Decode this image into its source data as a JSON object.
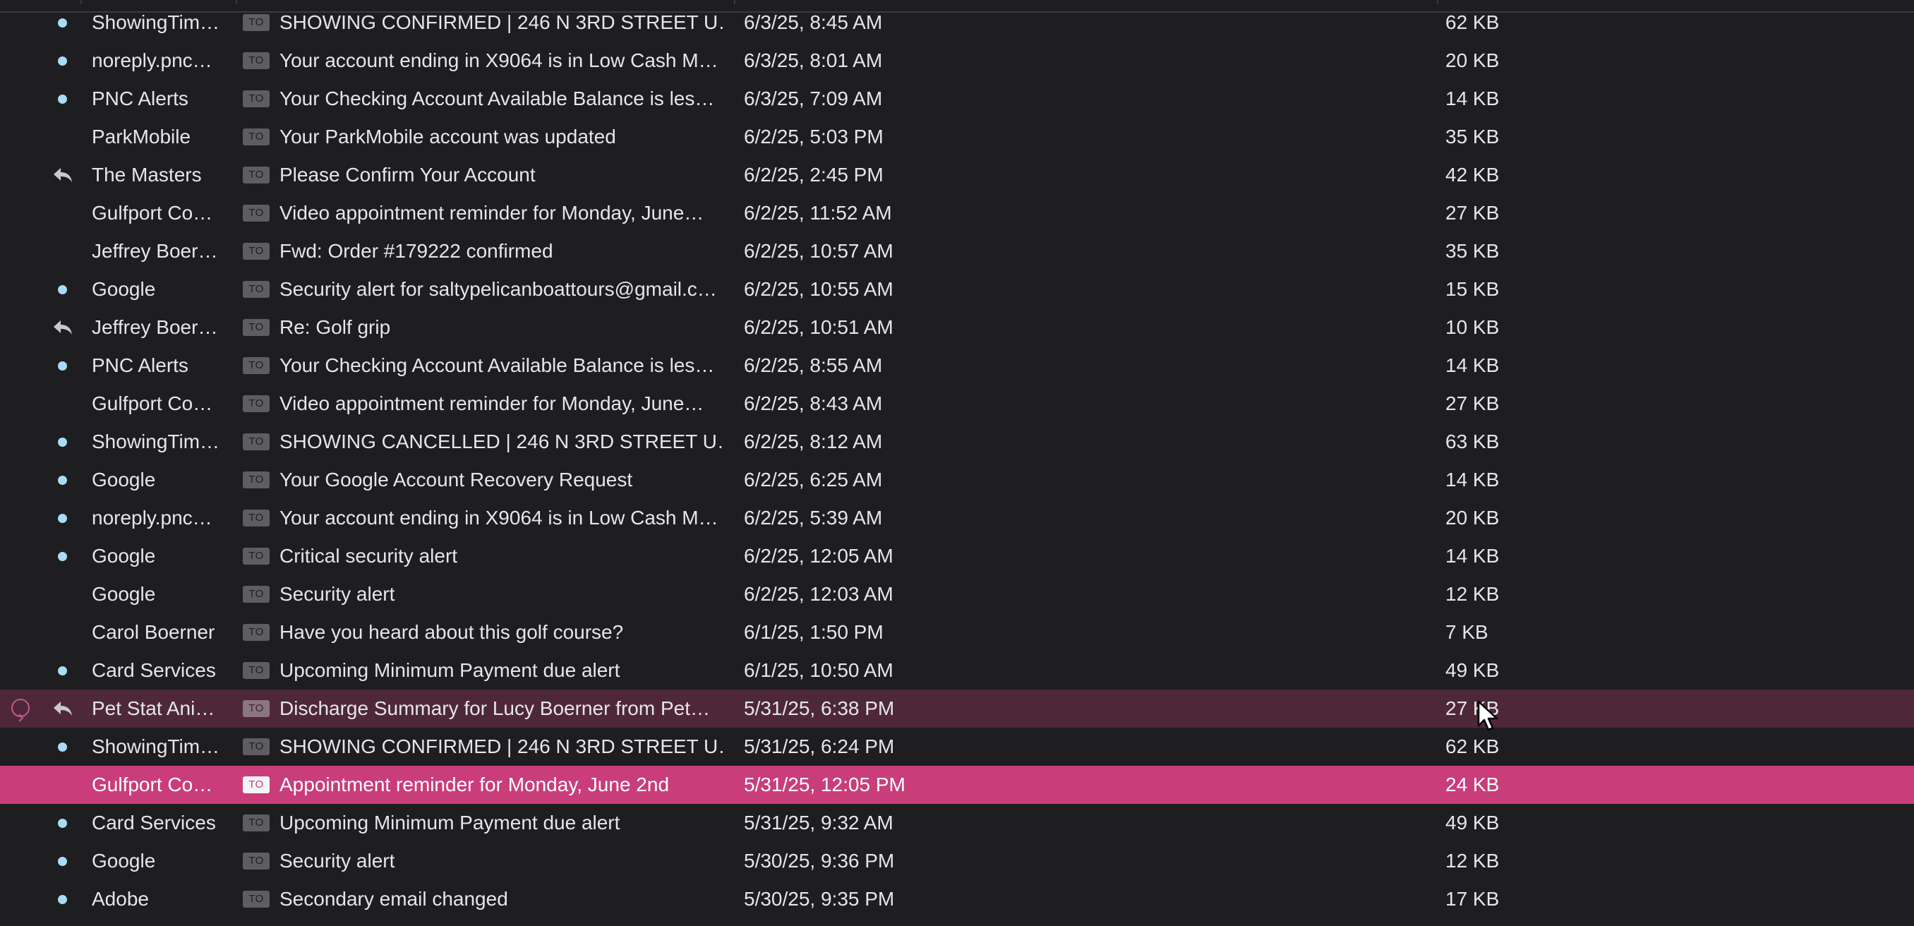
{
  "colors": {
    "background": "#1e1e21",
    "unread_dot": "#a8dcf5",
    "selected_row": "#c93d7a",
    "hover_row": "#4e2839"
  },
  "icons": {
    "unread": "unread-dot-icon",
    "replied": "reply-arrow-icon",
    "to_badge": "to-badge-icon",
    "thread": "chevron-circle-icon",
    "pointer": "mouse-cursor-icon"
  },
  "messages": [
    {
      "status": "unread",
      "from": "ShowingTim…",
      "badge": "TO",
      "subject": "SHOWING CONFIRMED | 246 N 3RD STREET U…",
      "date": "6/3/25, 8:45 AM",
      "size": "62 KB"
    },
    {
      "status": "unread",
      "from": "noreply.pnc…",
      "badge": "TO",
      "subject": "Your account ending in X9064 is in Low Cash M…",
      "date": "6/3/25, 8:01 AM",
      "size": "20 KB"
    },
    {
      "status": "unread",
      "from": "PNC Alerts",
      "badge": "TO",
      "subject": "Your Checking Account Available Balance is les…",
      "date": "6/3/25, 7:09 AM",
      "size": "14 KB"
    },
    {
      "status": "read",
      "from": "ParkMobile",
      "badge": "TO",
      "subject": "Your ParkMobile account was updated",
      "date": "6/2/25, 5:03 PM",
      "size": "35 KB"
    },
    {
      "status": "replied",
      "from": "The Masters",
      "badge": "TO",
      "subject": "Please Confirm Your Account",
      "date": "6/2/25, 2:45 PM",
      "size": "42 KB"
    },
    {
      "status": "read",
      "from": "Gulfport Co…",
      "badge": "TO",
      "subject": "Video appointment reminder for Monday, June…",
      "date": "6/2/25, 11:52 AM",
      "size": "27 KB"
    },
    {
      "status": "read",
      "from": "Jeffrey Boer…",
      "badge": "TO",
      "subject": "Fwd: Order #179222 confirmed",
      "date": "6/2/25, 10:57 AM",
      "size": "35 KB"
    },
    {
      "status": "unread",
      "from": "Google",
      "badge": "TO",
      "subject": "Security alert for saltypelicanboattours@gmail.c…",
      "date": "6/2/25, 10:55 AM",
      "size": "15 KB"
    },
    {
      "status": "replied",
      "from": "Jeffrey Boer…",
      "badge": "TO",
      "subject": "Re: Golf grip",
      "date": "6/2/25, 10:51 AM",
      "size": "10 KB"
    },
    {
      "status": "unread",
      "from": "PNC Alerts",
      "badge": "TO",
      "subject": "Your Checking Account Available Balance is les…",
      "date": "6/2/25, 8:55 AM",
      "size": "14 KB"
    },
    {
      "status": "read",
      "from": "Gulfport Co…",
      "badge": "TO",
      "subject": "Video appointment reminder for Monday, June…",
      "date": "6/2/25, 8:43 AM",
      "size": "27 KB"
    },
    {
      "status": "unread",
      "from": "ShowingTim…",
      "badge": "TO",
      "subject": "SHOWING  CANCELLED | 246 N 3RD STREET U…",
      "date": "6/2/25, 8:12 AM",
      "size": "63 KB"
    },
    {
      "status": "unread",
      "from": "Google",
      "badge": "TO",
      "subject": "Your Google Account Recovery Request",
      "date": "6/2/25, 6:25 AM",
      "size": "14 KB"
    },
    {
      "status": "unread",
      "from": "noreply.pnc…",
      "badge": "TO",
      "subject": "Your account ending in X9064 is in Low Cash M…",
      "date": "6/2/25, 5:39 AM",
      "size": "20 KB"
    },
    {
      "status": "unread",
      "from": "Google",
      "badge": "TO",
      "subject": "Critical security alert",
      "date": "6/2/25, 12:05 AM",
      "size": "14 KB"
    },
    {
      "status": "read",
      "from": "Google",
      "badge": "TO",
      "subject": "Security alert",
      "date": "6/2/25, 12:03 AM",
      "size": "12 KB"
    },
    {
      "status": "read",
      "from": "Carol Boerner",
      "badge": "TO",
      "subject": "Have you heard about this golf course?",
      "date": "6/1/25, 1:50 PM",
      "size": "7 KB"
    },
    {
      "status": "unread",
      "from": "Card Services",
      "badge": "TO",
      "subject": "Upcoming Minimum Payment due alert",
      "date": "6/1/25, 10:50 AM",
      "size": "49 KB"
    },
    {
      "status": "replied",
      "from": "Pet Stat Ani…",
      "badge": "TO",
      "subject": "Discharge Summary for Lucy Boerner from Pet…",
      "date": "5/31/25, 6:38 PM",
      "size": "27 KB",
      "state": "hover",
      "thread": true
    },
    {
      "status": "unread",
      "from": "ShowingTim…",
      "badge": "TO",
      "subject": "SHOWING CONFIRMED | 246 N 3RD STREET U…",
      "date": "5/31/25, 6:24 PM",
      "size": "62 KB"
    },
    {
      "status": "read",
      "from": "Gulfport Co…",
      "badge": "TO",
      "subject": "Appointment reminder for Monday, June 2nd",
      "date": "5/31/25, 12:05 PM",
      "size": "24 KB",
      "state": "selected"
    },
    {
      "status": "unread",
      "from": "Card Services",
      "badge": "TO",
      "subject": "Upcoming Minimum Payment due alert",
      "date": "5/31/25, 9:32 AM",
      "size": "49 KB"
    },
    {
      "status": "unread",
      "from": "Google",
      "badge": "TO",
      "subject": "Security alert",
      "date": "5/30/25, 9:36 PM",
      "size": "12 KB"
    },
    {
      "status": "unread",
      "from": "Adobe",
      "badge": "TO",
      "subject": "Secondary email changed",
      "date": "5/30/25, 9:35 PM",
      "size": "17 KB"
    }
  ]
}
